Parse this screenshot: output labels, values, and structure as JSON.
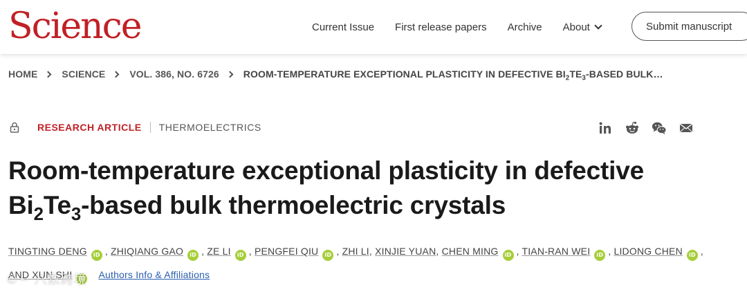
{
  "header": {
    "logo": "Science",
    "nav": {
      "current_issue": "Current Issue",
      "first_release": "First release papers",
      "archive": "Archive",
      "about": "About"
    },
    "submit_label": "Submit manuscript"
  },
  "breadcrumb": {
    "home": "HOME",
    "science": "SCIENCE",
    "volume": "VOL. 386, NO. 6726",
    "current_prefix": "ROOM-TEMPERATURE EXCEPTIONAL PLASTICITY IN DEFECTIVE BI",
    "current_sub1": "2",
    "current_mid": "TE",
    "current_sub2": "3",
    "current_suffix": "-BASED BULK…"
  },
  "article": {
    "type": "RESEARCH ARTICLE",
    "subject": "THERMOELECTRICS",
    "title_line1": "Room-temperature exceptional plasticity in defective",
    "title_l2_a": "Bi",
    "title_l2_sub1": "2",
    "title_l2_b": "Te",
    "title_l2_sub2": "3",
    "title_l2_c": "-based bulk thermoelectric crystals",
    "orcid_glyph": "iD",
    "authors": {
      "a1": "TINGTING DENG",
      "a2": "ZHIQIANG GAO",
      "a3": "ZE LI",
      "a4": "PENGFEI QIU",
      "a5": "ZHI LI",
      "a6": "XINJIE YUAN",
      "a7": "CHEN MING",
      "a8": "TIAN-RAN WEI",
      "a9": "LIDONG CHEN",
      "a10_prefix": "AND",
      "a10": "XUN SHI"
    },
    "affiliations_link": "Authors Info & Affiliations"
  },
  "share_icons": [
    "linkedin-icon",
    "reddit-icon",
    "wechat-icon",
    "email-icon"
  ],
  "watermark": "©~ 八数跨境",
  "colors": {
    "brand_red": "#c12026",
    "orcid_green": "#a6ce39",
    "link_blue": "#2a5db0"
  }
}
